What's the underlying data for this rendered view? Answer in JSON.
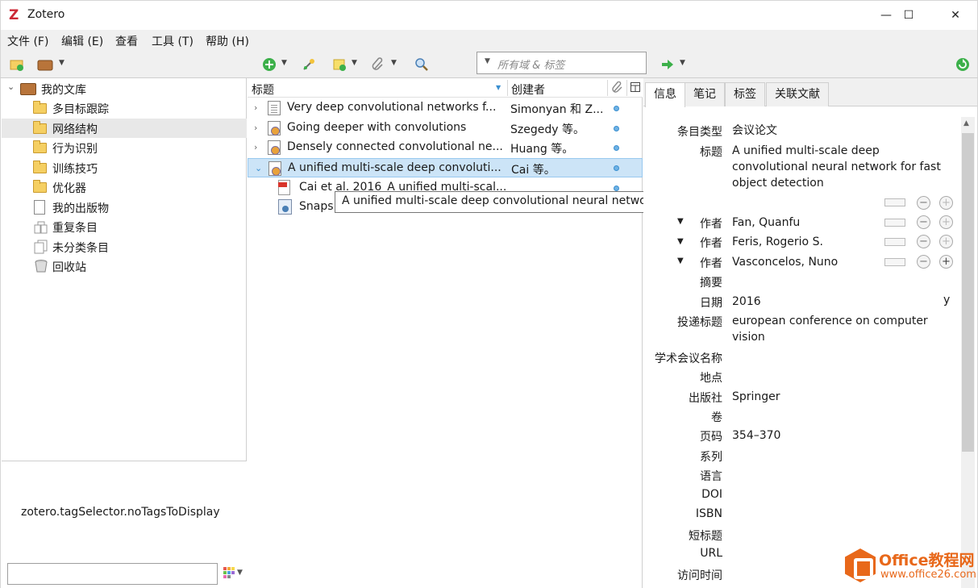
{
  "window": {
    "title": "Zotero",
    "logo_letter": "Z"
  },
  "window_controls": {
    "minimize": "—",
    "maximize": "☐",
    "close": "✕"
  },
  "menubar": [
    "文件 (F)",
    "编辑 (E)",
    "查看",
    "工具 (T)",
    "帮助 (H)"
  ],
  "toolbar": {
    "search_placeholder": "所有域 & 标签"
  },
  "collections": {
    "library": "我的文库",
    "items": [
      {
        "label": "多目标跟踪",
        "icon": "folder-icon"
      },
      {
        "label": "网络结构",
        "icon": "folder-icon",
        "selected": true
      },
      {
        "label": "行为识别",
        "icon": "folder-icon"
      },
      {
        "label": "训练技巧",
        "icon": "folder-icon"
      },
      {
        "label": "优化器",
        "icon": "folder-icon"
      },
      {
        "label": "我的出版物",
        "icon": "publications-icon"
      },
      {
        "label": "重复条目",
        "icon": "duplicates-icon"
      },
      {
        "label": "未分类条目",
        "icon": "unfiled-icon"
      },
      {
        "label": "回收站",
        "icon": "trash-icon"
      }
    ]
  },
  "tag_selector": {
    "message": "zotero.tagSelector.noTagsToDisplay"
  },
  "items_list": {
    "columns": {
      "title": "标题",
      "creator": "创建者"
    },
    "rows": [
      {
        "title": "Very deep convolutional networks f...",
        "creator": "Simonyan 和 Z...",
        "icon": "document-icon",
        "twisty": "›"
      },
      {
        "title": "Going deeper with convolutions",
        "creator": "Szegedy 等。",
        "icon": "conference-paper-icon",
        "twisty": "›"
      },
      {
        "title": "Densely connected convolutional ne...",
        "creator": "Huang 等。",
        "icon": "conference-paper-icon",
        "twisty": "›"
      },
      {
        "title": "A unified multi-scale deep convoluti...",
        "creator": "Cai 等。",
        "icon": "conference-paper-icon",
        "twisty": "⌄",
        "selected": true
      }
    ],
    "children": [
      {
        "title": "Cai et al. 2016_A unified multi-scal...",
        "icon": "pdf-icon"
      },
      {
        "title": "Snaps",
        "icon": "snapshot-icon"
      }
    ],
    "tooltip": "A unified multi-scale deep convolutional neural network for fast object detection"
  },
  "item_pane": {
    "tabs": [
      "信息",
      "笔记",
      "标签",
      "关联文献"
    ],
    "fields": {
      "item_type_label": "条目类型",
      "item_type": "会议论文",
      "title_label": "标题",
      "title": "A unified multi-scale deep convolutional neural network for fast object detection",
      "author_label": "作者",
      "authors": [
        "Fan, Quanfu",
        "Feris, Rogerio S.",
        "Vasconcelos, Nuno"
      ],
      "abstract_label": "摘要",
      "date_label": "日期",
      "date": "2016",
      "date_suffix": "y",
      "proceedings_label": "投递标题",
      "proceedings": "european conference on computer vision",
      "conference_label": "学术会议名称",
      "place_label": "地点",
      "publisher_label": "出版社",
      "publisher": "Springer",
      "volume_label": "卷",
      "pages_label": "页码",
      "pages": "354–370",
      "series_label": "系列",
      "language_label": "语言",
      "doi_label": "DOI",
      "isbn_label": "ISBN",
      "short_title_label": "短标题",
      "url_label": "URL",
      "accessed_label": "访问时间"
    }
  },
  "watermark": {
    "line1": "Office教程网",
    "line2": "www.office26.com"
  }
}
